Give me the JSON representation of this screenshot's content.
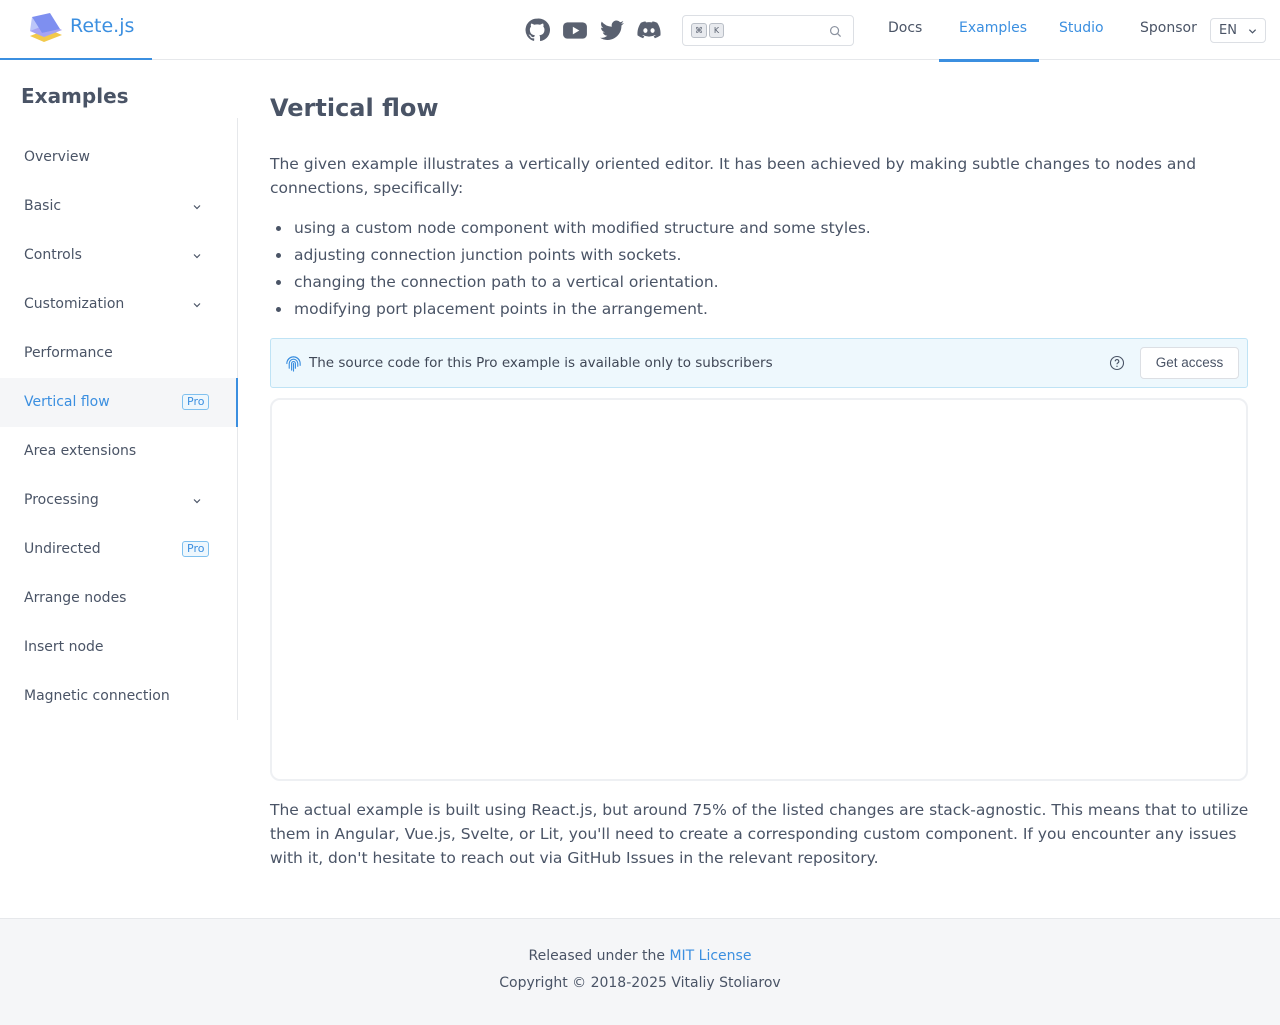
{
  "header": {
    "brand": "Rete.js",
    "social": [
      "github-icon",
      "youtube-icon",
      "twitter-icon",
      "discord-icon"
    ],
    "search": {
      "kbd_modifier": "⌘",
      "kbd_key": "K",
      "placeholder": ""
    },
    "nav": [
      {
        "label": "Docs",
        "active": false
      },
      {
        "label": "Examples",
        "active": true
      },
      {
        "label": "Studio",
        "active": false
      },
      {
        "label": "Sponsor",
        "active": false
      }
    ],
    "language": "EN"
  },
  "sidebar": {
    "title": "Examples",
    "items": [
      {
        "label": "Overview",
        "expandable": false,
        "badge": ""
      },
      {
        "label": "Basic",
        "expandable": true,
        "badge": ""
      },
      {
        "label": "Controls",
        "expandable": true,
        "badge": ""
      },
      {
        "label": "Customization",
        "expandable": true,
        "badge": ""
      },
      {
        "label": "Performance",
        "expandable": false,
        "badge": ""
      },
      {
        "label": "Vertical flow",
        "expandable": false,
        "badge": "Pro",
        "active": true
      },
      {
        "label": "Area extensions",
        "expandable": false,
        "badge": ""
      },
      {
        "label": "Processing",
        "expandable": true,
        "badge": ""
      },
      {
        "label": "Undirected",
        "expandable": false,
        "badge": "Pro"
      },
      {
        "label": "Arrange nodes",
        "expandable": false,
        "badge": ""
      },
      {
        "label": "Insert node",
        "expandable": false,
        "badge": ""
      },
      {
        "label": "Magnetic connection",
        "expandable": false,
        "badge": ""
      }
    ]
  },
  "main": {
    "title": "Vertical flow",
    "intro": "The given example illustrates a vertically oriented editor. It has been achieved by making subtle changes to nodes and connections, specifically:",
    "bullets": [
      "using a custom node component with modified structure and some styles.",
      "adjusting connection junction points with sockets.",
      "changing the connection path to a vertical orientation.",
      "modifying port placement points in the arrangement."
    ],
    "notice": {
      "text": "The source code for this Pro example is available only to subscribers",
      "button": "Get access"
    },
    "outro": "The actual example is built using React.js, but around 75% of the listed changes are stack-agnostic. This means that to utilize them in Angular, Vue.js, Svelte, or Lit, you'll need to create a corresponding custom component. If you encounter any issues with it, don't hesitate to reach out via GitHub Issues in the relevant repository."
  },
  "footer": {
    "released_prefix": "Released under the",
    "license_link": "MIT License",
    "copyright": "Copyright © 2018-2025 Vitaliy Stoliarov"
  },
  "colors": {
    "accent": "#3b8fe0",
    "text": "#4a5466",
    "notice_bg": "#eef8fd"
  }
}
